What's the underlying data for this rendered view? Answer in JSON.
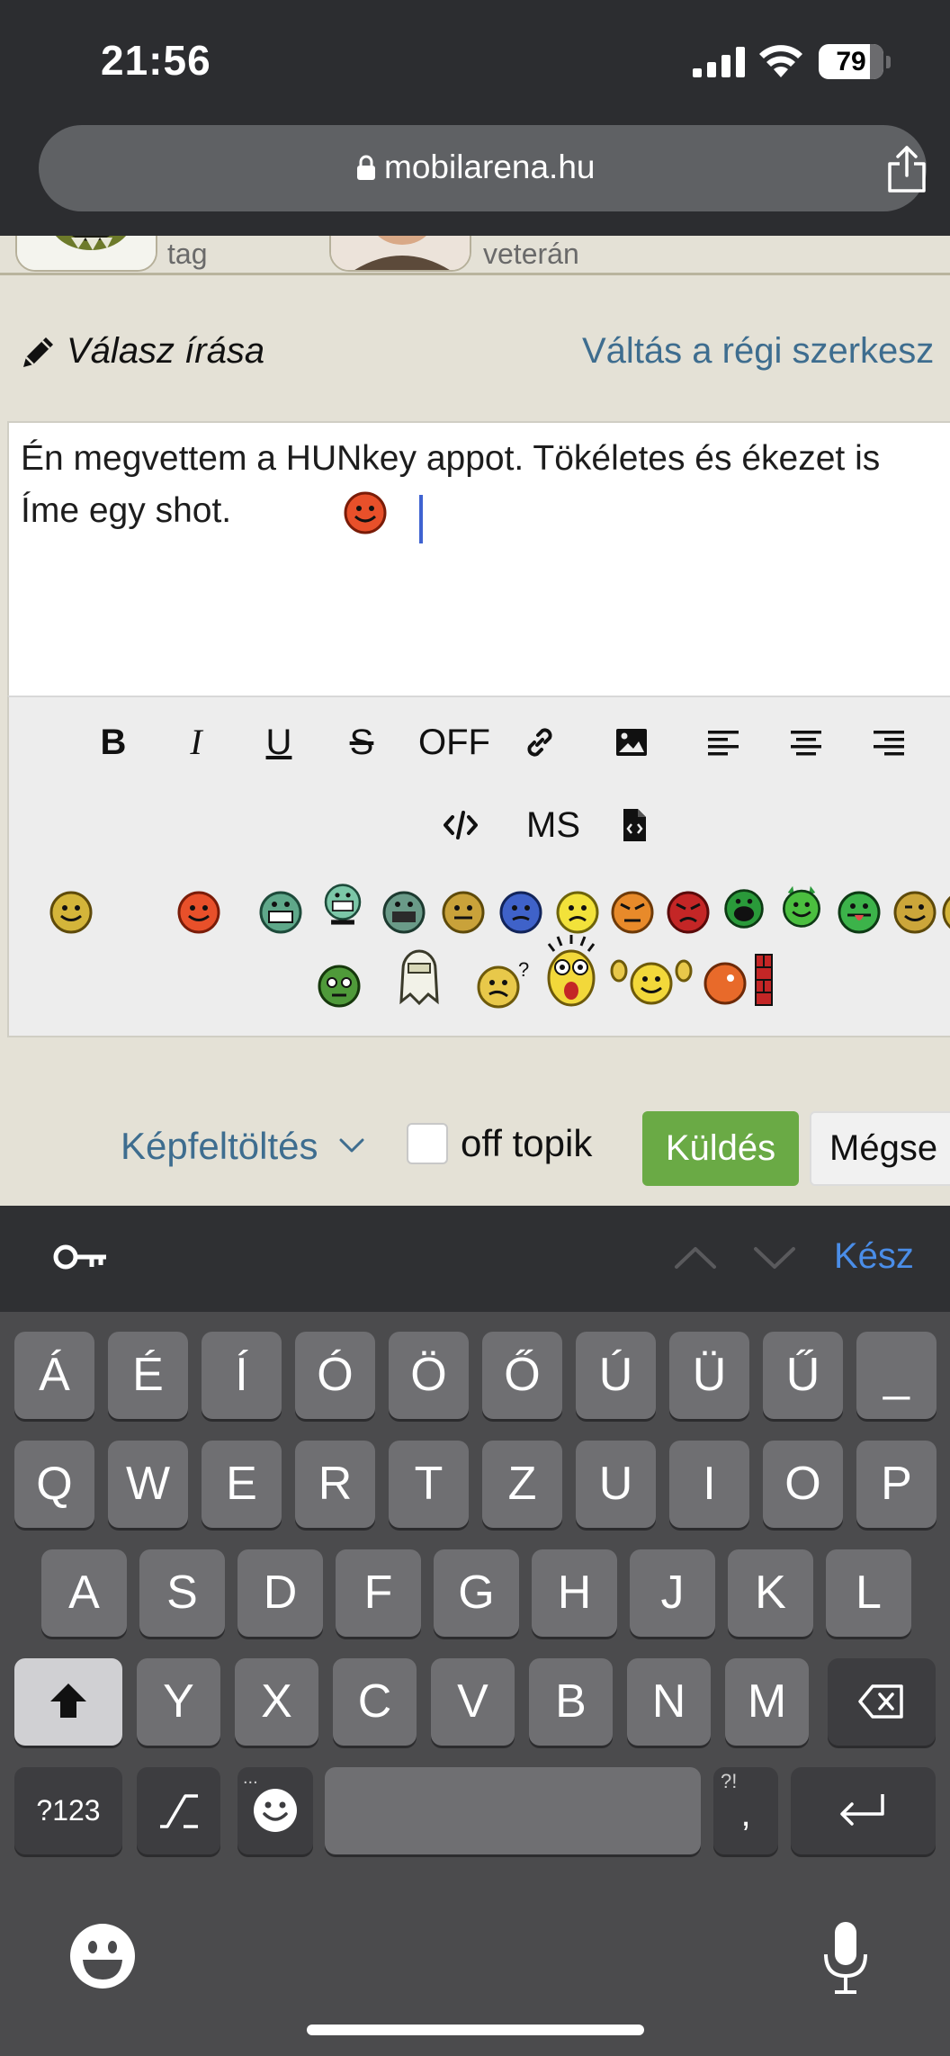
{
  "status_bar": {
    "time": "21:56",
    "battery_level": "79"
  },
  "browser": {
    "url": "mobilarena.hu"
  },
  "users": [
    {
      "rank": "tag"
    },
    {
      "rank": "veterán"
    }
  ],
  "reply": {
    "title": "Válasz írása",
    "switch_editor_link": "Váltás a régi szerkesz"
  },
  "editor": {
    "line_1": "Én megvettem a HUNkey appot. Tökéletes és ékezet is",
    "line_2": "Íme egy shot."
  },
  "toolbar": {
    "bold": "B",
    "italic": "I",
    "underline": "U",
    "strike": "S",
    "off": "OFF",
    "ms": "MS"
  },
  "actions": {
    "upload_label": "Képfeltöltés",
    "offtopic_label": "off topik",
    "send_label": "Küldés",
    "cancel_label": "Mégse"
  },
  "keyboard_accessory": {
    "done_label": "Kész"
  },
  "keyboard": {
    "row_accents": [
      "Á",
      "É",
      "Í",
      "Ó",
      "Ö",
      "Ő",
      "Ú",
      "Ü",
      "Ű",
      "_"
    ],
    "row_1": [
      "Q",
      "W",
      "E",
      "R",
      "T",
      "Z",
      "U",
      "I",
      "O",
      "P"
    ],
    "row_2": [
      "A",
      "S",
      "D",
      "F",
      "G",
      "H",
      "J",
      "K",
      "L"
    ],
    "row_3": [
      "Y",
      "X",
      "C",
      "V",
      "B",
      "N",
      "M"
    ],
    "numbers_key": "?123",
    "comma_key": ",",
    "comma_hint": "?!",
    "emoji_hint": "..."
  },
  "colors": {
    "link": "#3e6d8f",
    "send_button": "#6aaa45",
    "done": "#4a8de8",
    "caret": "#3f63d1"
  }
}
